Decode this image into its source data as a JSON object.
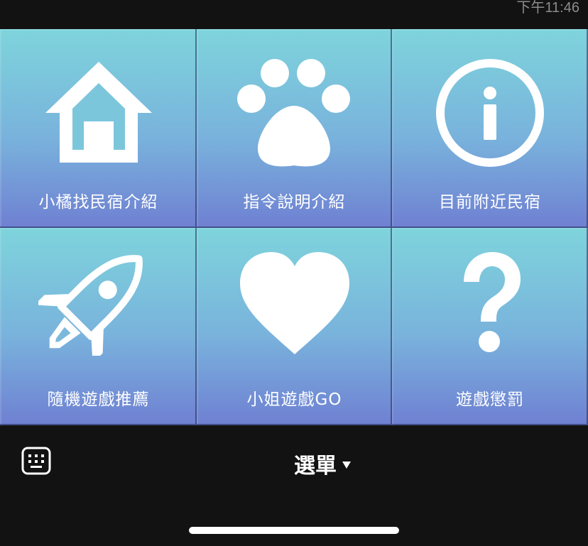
{
  "status": {
    "time": "下午11:46"
  },
  "rich_menu": {
    "tiles": [
      {
        "label": "小橘找民宿介紹",
        "icon": "house-icon"
      },
      {
        "label": "指令說明介紹",
        "icon": "paw-icon"
      },
      {
        "label": "目前附近民宿",
        "icon": "info-icon"
      },
      {
        "label": "隨機遊戲推薦",
        "icon": "rocket-icon"
      },
      {
        "label": "小姐遊戲GO",
        "icon": "heart-icon"
      },
      {
        "label": "遊戲懲罰",
        "icon": "question-mark-icon"
      }
    ],
    "colors": {
      "gradient_top": "#7ed4dc",
      "gradient_bottom": "#6f80d2",
      "icon": "#ffffff"
    }
  },
  "bottom_bar": {
    "menu_label": "選單",
    "keyboard_icon": "keyboard-icon",
    "caret_icon": "caret-down-icon"
  }
}
